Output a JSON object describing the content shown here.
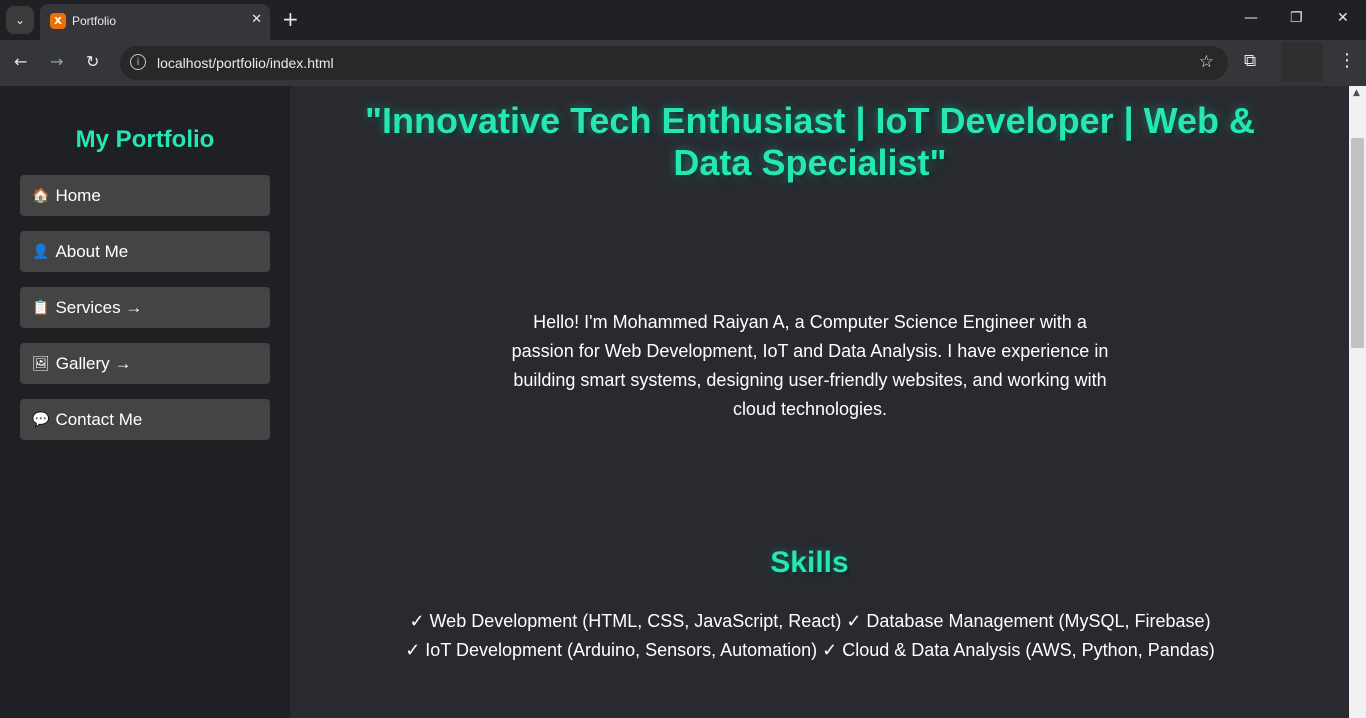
{
  "browser": {
    "tab_title": "Portfolio",
    "favicon_letter": "X",
    "new_tab": "+",
    "url": "localhost/portfolio/index.html",
    "win_minimize": "—",
    "win_restore": "❐",
    "win_close": "✕"
  },
  "sidebar": {
    "logo": "My Portfolio",
    "items": [
      {
        "icon": "🏠",
        "label": "Home"
      },
      {
        "icon": "👤",
        "label": "About Me"
      },
      {
        "icon": "📋",
        "label": "Services →"
      },
      {
        "icon": "🖼",
        "label": "Gallery →"
      },
      {
        "icon": "💬",
        "label": "Contact Me"
      }
    ]
  },
  "main": {
    "headline": "\"Innovative Tech Enthusiast | IoT Developer | Web & Data Specialist\"",
    "intro": "Hello! I'm Mohammed Raiyan A, a Computer Science Engineer with a passion for Web Development, IoT and Data Analysis. I have experience in building smart systems, designing user-friendly websites, and working with cloud technologies.",
    "skills_title": "Skills",
    "skills_text": "✓ Web Development (HTML, CSS, JavaScript, React) ✓ Database Management (MySQL, Firebase) ✓ IoT Development (Arduino, Sensors, Automation) ✓ Cloud & Data Analysis (AWS, Python, Pandas)"
  },
  "colors": {
    "accent": "#26e6b4",
    "sidebar_bg": "#1e2024",
    "main_bg": "#282a2f",
    "nav_item_bg": "#444444"
  }
}
